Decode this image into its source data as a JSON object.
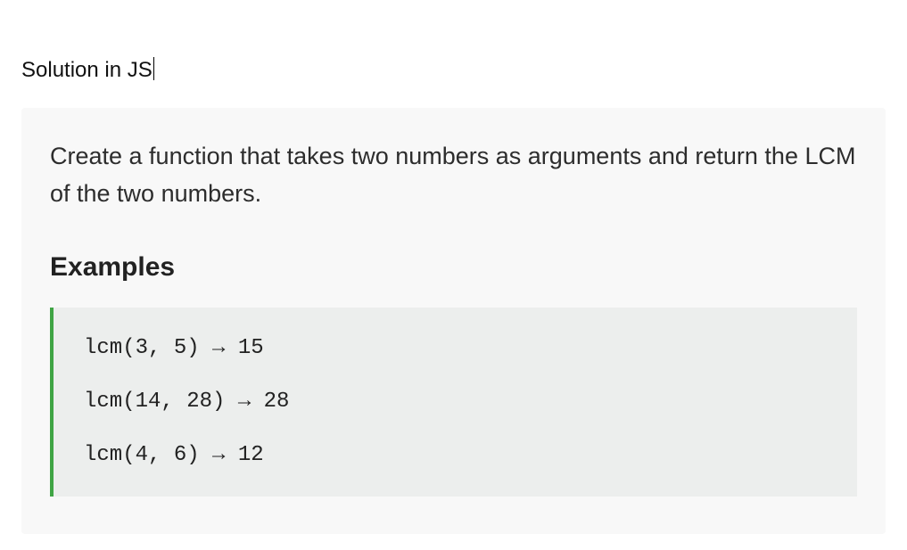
{
  "title": "Solution in JS",
  "problem_text": "Create a function that takes two numbers as arguments and return the LCM of the two numbers.",
  "examples_heading": "Examples",
  "arrow_glyph": "→",
  "code_examples": [
    {
      "call": "lcm(3, 5)",
      "result": "15"
    },
    {
      "call": "lcm(14, 28)",
      "result": "28"
    },
    {
      "call": "lcm(4, 6)",
      "result": "12"
    }
  ]
}
